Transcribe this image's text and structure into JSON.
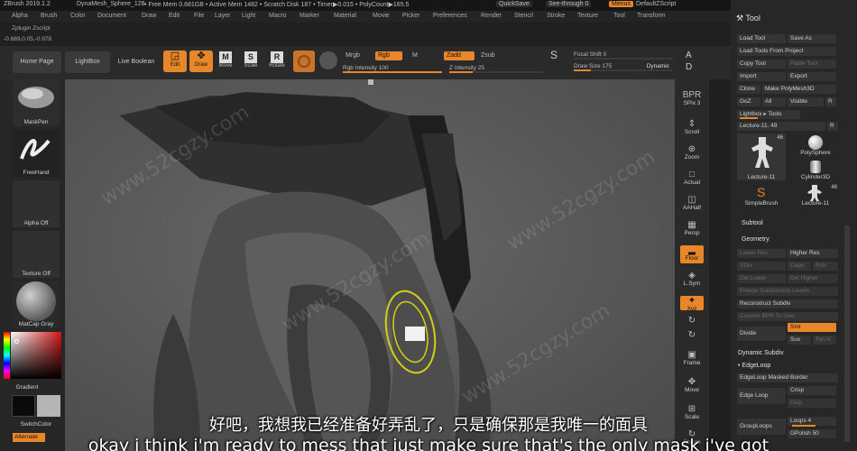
{
  "titlebar": {
    "app": "ZBrush 2019.1.2",
    "doc": "DynaMesh_Sphere_128",
    "stats": "• Free Mem 0.681GB • Active Mem 1482 • Scratch Disk 187 • Timer▶0.015 • PolyCount▶165.5",
    "quicksave": "QuickSave",
    "seethrough": "See-through  0",
    "menus": "Menus",
    "script": "DefaultZScript"
  },
  "menubar": [
    "Alpha",
    "Brush",
    "Color",
    "Document",
    "Draw",
    "Edit",
    "File",
    "Layer",
    "Light",
    "Macro",
    "Marker",
    "Material",
    "Movie",
    "Picker",
    "Preferences",
    "Render",
    "Stencil",
    "Stroke",
    "Texture",
    "Tool",
    "Transform"
  ],
  "infobar": {
    "line1": "Zplugin    Zscript",
    "coords": "-0.889,0.05,-0.978"
  },
  "toolbar": {
    "home": "Home Page",
    "lightbox": "LightBox",
    "liveboolean": "Live Boolean",
    "edit": "Edit",
    "draw": "Draw",
    "move": "Move",
    "scale": "Scale",
    "rotate": "Rotate",
    "mrgb": "Mrgb",
    "rgb": "Rgb",
    "m": "M",
    "rgb_intensity": "Rgb Intensity 100",
    "zadd": "Zadd",
    "zsub": "Zsub",
    "z_intensity": "Z Intensity 25",
    "focal_shift": "Focal Shift 0",
    "draw_size": "Draw Size 175",
    "dynamic": "Dynamic",
    "rgb_intensity_value": 100,
    "z_intensity_value": 25,
    "draw_size_value": 175
  },
  "leftshelf": {
    "brush": "MaskPen",
    "stroke": "FreeHand",
    "alpha": "Alpha Off",
    "texture": "Texture Off",
    "material": "MatCap Gray",
    "gradient": "Gradient",
    "switchcolor": "SwitchColor",
    "alternate": "Alternate"
  },
  "rightshelf": [
    {
      "icon": "BPR",
      "label": "SPix 3"
    },
    {
      "icon": "⇕",
      "label": "Scroll"
    },
    {
      "icon": "⊕",
      "label": "Zoom"
    },
    {
      "icon": "□",
      "label": "Actual"
    },
    {
      "icon": "◫",
      "label": "AAHalf"
    },
    {
      "icon": "▦",
      "label": "Persp"
    },
    {
      "icon": "▂",
      "label": "Floor"
    },
    {
      "icon": "◈",
      "label": "L.Sym"
    },
    {
      "icon": "✦",
      "label": "Xyz"
    },
    {
      "icon": "↻",
      "label": ""
    },
    {
      "icon": "↻",
      "label": ""
    },
    {
      "icon": "▣",
      "label": "Frame"
    },
    {
      "icon": "✥",
      "label": "Move"
    },
    {
      "icon": "⊞",
      "label": "Scale"
    },
    {
      "icon": "↻",
      "label": "Rotate"
    }
  ],
  "toolpanel": {
    "title": "Tool",
    "buttons": [
      "Load Tool",
      "Save As",
      "Load Tools From Project",
      "Copy Tool",
      "Paste Tool",
      "Import",
      "Export",
      "Clone",
      "Make PolyMesh3D",
      "GoZ",
      "All",
      "Visible",
      "R"
    ],
    "lightbox_tools": "Lightbox ▸ Tools",
    "lecture": "Lecture-11. 49",
    "r": "R",
    "thumbs": [
      {
        "label": "Lecture-11",
        "badge": "46"
      },
      {
        "label": "PolySphere",
        "badge": ""
      },
      {
        "label": "Cylinder3D",
        "badge": ""
      },
      {
        "label": "SimpleBrush",
        "badge": ""
      },
      {
        "label": "Lecture-11",
        "badge": "46"
      }
    ],
    "subtool": "Subtool",
    "geometry": "Geometry",
    "lower_res": "Lower Res",
    "higher_res": "Higher Res",
    "sdiv": "SDiv",
    "cage": "Cage",
    "rstr": "Rstr",
    "del_lower": "Del Lower",
    "del_higher": "Del Higher",
    "freeze": "Freeze SubDivision Levels",
    "reconstruct": "Reconstruct Subdiv",
    "convert_bpr": "Convert BPR To Geo",
    "divide": "Divide",
    "smt": "Smt",
    "suv": "Suv",
    "reuv": "ReUV",
    "dynamic_subdiv": "Dynamic Subdiv",
    "edgeloop": "EdgeLoop",
    "edgeloop_masked": "EdgeLoop Masked Border",
    "edge_loop": "Edge Loop",
    "crisp": "Crisp",
    "disp": "Disp",
    "grouploops": "GroupLoops",
    "loops": "Loops 4",
    "gpolish": "GPolish 50"
  },
  "subtitles": {
    "cn": "好吧，我想我已经准备好弄乱了，只是确保那是我唯一的面具",
    "en": "okay i think i'm ready to mess that just make sure that's the only mask i've got"
  },
  "watermark": "www.52cgzy.com",
  "colors": {
    "accent": "#e8872a",
    "bg": "#272727",
    "canvas": "#5a5a5a"
  }
}
